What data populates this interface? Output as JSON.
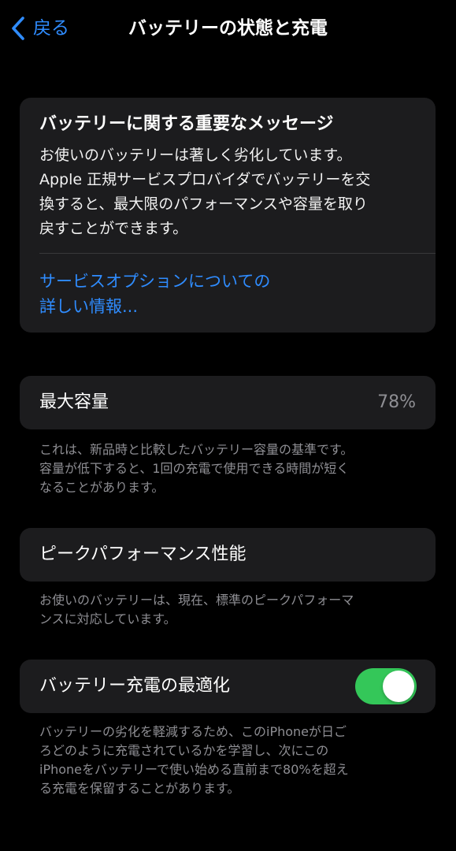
{
  "nav": {
    "back_label": "戻る",
    "title": "バッテリーの状態と充電"
  },
  "message": {
    "title": "バッテリーに関する重要なメッセージ",
    "body_lines": [
      "お使いのバッテリーは著しく劣化しています。",
      "Apple 正規サービスプロバイダでバッテリーを交",
      "換すると、最大限のパフォーマンスや容量を取り",
      "戻すことができます。"
    ],
    "link_lines": [
      "サービスオプションについての",
      "詳しい情報..."
    ]
  },
  "max_capacity": {
    "label": "最大容量",
    "value": "78%",
    "footnote_lines": [
      "これは、新品時と比較したバッテリー容量の基準です。",
      "容量が低下すると、1回の充電で使用できる時間が短く",
      "なることがあります。"
    ]
  },
  "peak_performance": {
    "label": "ピークパフォーマンス性能",
    "footnote_lines": [
      "お使いのバッテリーは、現在、標準のピークパフォーマ",
      "ンスに対応しています。"
    ]
  },
  "optimized_charging": {
    "label": "バッテリー充電の最適化",
    "enabled": true,
    "footnote_lines": [
      "バッテリーの劣化を軽減するため、このiPhoneが日ご",
      "ろどのように充電されているかを学習し、次にこの",
      "iPhoneをバッテリーで使い始める直前まで80%を超え",
      "る充電を保留することがあります。"
    ]
  },
  "colors": {
    "background": "#000000",
    "card": "#1c1c1e",
    "accent_blue": "#2f8cff",
    "toggle_on": "#34c759",
    "secondary_text": "#8e8e93"
  },
  "icons": {
    "back": "chevron-left-icon"
  }
}
